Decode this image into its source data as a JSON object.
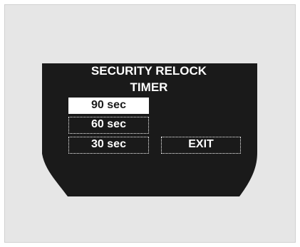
{
  "screen": {
    "title_line_1": "SECURITY RELOCK",
    "title_line_2": "TIMER"
  },
  "options": {
    "opt_90": "90 sec",
    "opt_60": "60 sec",
    "opt_30": "30 sec",
    "exit": "EXIT"
  },
  "selected_option": "90 sec",
  "colors": {
    "display_bg": "#1a1a1a",
    "text": "#ffffff",
    "frame_bg": "#e6e6e6"
  }
}
